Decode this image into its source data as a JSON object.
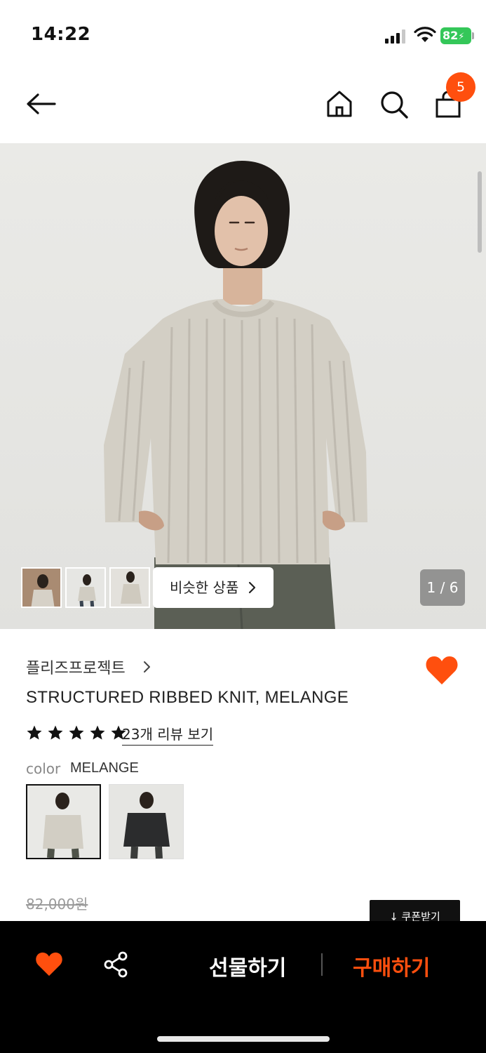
{
  "status_bar": {
    "time": "14:22",
    "battery": "82"
  },
  "cart": {
    "count": "5"
  },
  "gallery": {
    "page_indicator": "1 / 6",
    "similar_label": "비슷한 상품"
  },
  "product": {
    "brand": "플리즈프로젝트",
    "title": "STRUCTURED RIBBED KNIT, MELANGE",
    "rating_stars": 5,
    "reviews_link": "23개 리뷰 보기",
    "color_label": "color",
    "color_value": "MELANGE",
    "original_price": "82,000원",
    "coupon_label": "↓ 쿠폰받기",
    "favorited": true
  },
  "actions": {
    "gift_label": "선물하기",
    "buy_label": "구매하기"
  },
  "colors": {
    "accent": "#ff4f0e",
    "bar": "#000000",
    "battery": "#34c759"
  }
}
